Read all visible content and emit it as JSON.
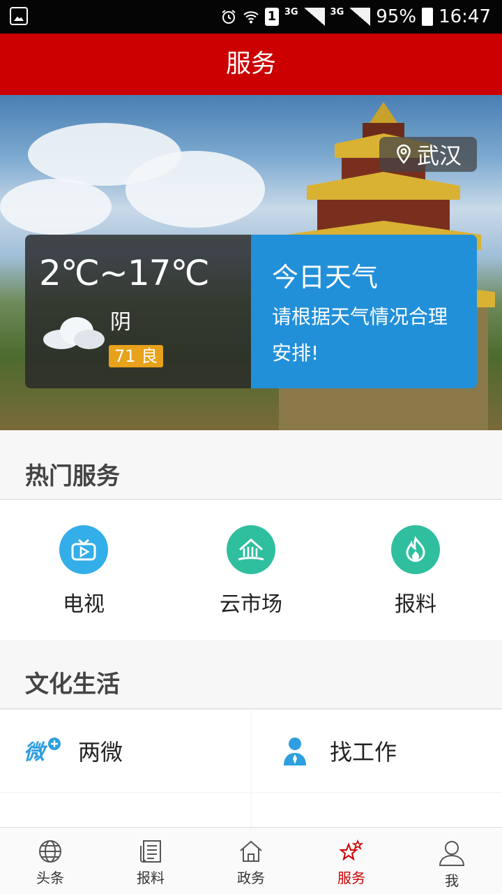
{
  "status_bar": {
    "battery": "95%",
    "time": "16:47",
    "sim": "1",
    "net1": "3G",
    "net2": "3G"
  },
  "header": {
    "title": "服务"
  },
  "banner": {
    "location": "武汉",
    "weather": {
      "temp_range": "2℃~17℃",
      "condition": "阴",
      "aqi": "71 良"
    },
    "tip": {
      "title": "今日天气",
      "text": "请根据天气情况合理安排!"
    }
  },
  "hot_services": {
    "title": "热门服务",
    "items": [
      {
        "label": "电视",
        "icon": "tv-icon",
        "color": "#33aee8"
      },
      {
        "label": "云市场",
        "icon": "cloud-market-icon",
        "color": "#2fbf9f"
      },
      {
        "label": "报料",
        "icon": "fire-icon",
        "color": "#2fbf9f"
      }
    ]
  },
  "culture": {
    "title": "文化生活",
    "items": [
      {
        "label": "两微",
        "icon": "weibo-plus-icon"
      },
      {
        "label": "找工作",
        "icon": "person-icon"
      }
    ]
  },
  "bottom_nav": {
    "items": [
      {
        "label": "头条",
        "icon": "globe-icon"
      },
      {
        "label": "报料",
        "icon": "newspaper-icon"
      },
      {
        "label": "政务",
        "icon": "home-icon"
      },
      {
        "label": "服务",
        "icon": "stars-icon",
        "active": true
      },
      {
        "label": "我",
        "icon": "user-icon"
      }
    ]
  },
  "colors": {
    "brand_red": "#cc0000",
    "tip_blue": "#2290d9",
    "aqi_orange": "#e8a11a"
  }
}
